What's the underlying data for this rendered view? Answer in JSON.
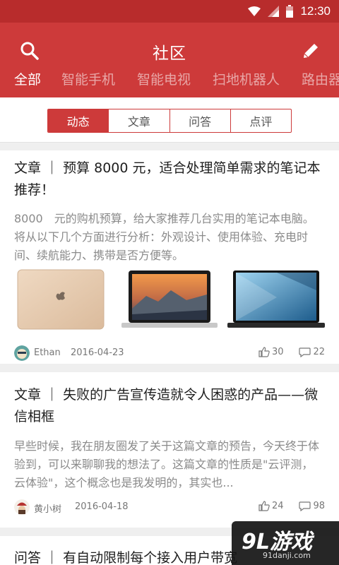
{
  "status_bar": {
    "time": "12:30",
    "icons": [
      "wifi-icon",
      "signal-icon",
      "battery-icon"
    ]
  },
  "header": {
    "title": "社区",
    "search_icon": "search-icon",
    "edit_icon": "pencil-icon"
  },
  "category_tabs": [
    {
      "label": "全部",
      "active": true
    },
    {
      "label": "智能手机",
      "active": false
    },
    {
      "label": "智能电视",
      "active": false
    },
    {
      "label": "扫地机器人",
      "active": false
    },
    {
      "label": "路由器",
      "active": false
    }
  ],
  "segments": [
    {
      "label": "动态",
      "active": true
    },
    {
      "label": "文章",
      "active": false
    },
    {
      "label": "问答",
      "active": false
    },
    {
      "label": "点评",
      "active": false
    }
  ],
  "posts": [
    {
      "title": "文章 ｜ 预算 8000 元，适合处理简单需求的笔记本推荐！",
      "summary": "8000　元的购机预算，给大家推荐几台实用的笔记本电脑。将从以下几个方面进行分析：外观设计、使用体验、充电时间、续航能力、携带是否方便等。",
      "author": "Ethan",
      "date": "2016-04-23",
      "likes": "30",
      "comments": "22"
    },
    {
      "title": "文章 ｜ 失败的广告宣传造就令人困惑的产品——微信相框",
      "summary": "早些时候，我在朋友圈发了关于这篇文章的预告，今天终于体验到，可以来聊聊我的想法了。这篇文章的性质是\"云评测，云体验\"，这个概念也是我发明的，其实也...",
      "author": "黄小树",
      "date": "2016-04-18",
      "likes": "24",
      "comments": "98"
    },
    {
      "title": "问答 ｜ 有自动限制每个接入用户带宽"
    }
  ],
  "watermark": {
    "logo": "9L游戏",
    "url": "91danji.com"
  },
  "colors": {
    "brand": "#cd3a3a",
    "status_bar": "#b82c2c"
  }
}
